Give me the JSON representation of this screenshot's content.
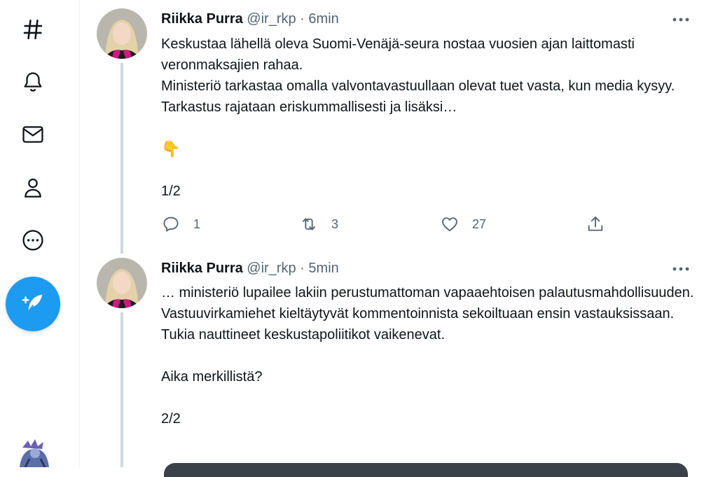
{
  "nav": {
    "items": [
      {
        "name": "explore",
        "icon": "hashtag-icon"
      },
      {
        "name": "notifications",
        "icon": "bell-icon"
      },
      {
        "name": "messages",
        "icon": "envelope-icon"
      },
      {
        "name": "profile",
        "icon": "person-icon"
      },
      {
        "name": "more",
        "icon": "more-circle-icon"
      }
    ],
    "compose_icon": "feather-plus-icon",
    "accent": "#1d9bf0"
  },
  "tweets": [
    {
      "name": "Riikka Purra",
      "handle": "@ir_rkp",
      "separator": "·",
      "time": "6min",
      "lines": [
        "Keskustaa lähellä oleva Suomi-Venäjä-seura nostaa vuosien ajan laittomasti veronmaksajien rahaa.",
        "Ministeriö tarkastaa omalla valvontavastuullaan olevat tuet vasta, kun media kysyy. Tarkastus rajataan eriskummallisesti ja lisäksi…",
        "",
        "👇",
        "",
        "1/2"
      ],
      "actions": {
        "replies": "1",
        "retweets": "3",
        "likes": "27"
      }
    },
    {
      "name": "Riikka Purra",
      "handle": "@ir_rkp",
      "separator": "·",
      "time": "5min",
      "lines": [
        "… ministeriö lupailee lakiin perustumattoman vapaaehtoisen palautusmahdollisuuden. Vastuuvirkamiehet kieltäytyvät kommentoinnista sekoiltuaan ensin vastauksissaan.",
        "Tukia nauttineet keskustapoliitikot vaikenevat.",
        "",
        "Aika merkillistä?",
        "",
        "2/2"
      ]
    }
  ]
}
